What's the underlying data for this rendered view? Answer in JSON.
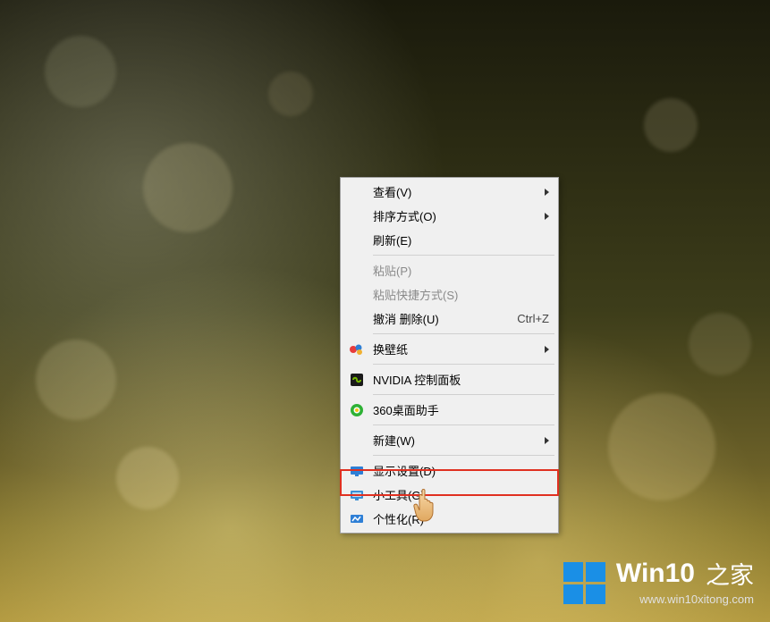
{
  "menu": {
    "view": {
      "label": "查看(V)"
    },
    "sort": {
      "label": "排序方式(O)"
    },
    "refresh": {
      "label": "刷新(E)"
    },
    "paste": {
      "label": "粘贴(P)"
    },
    "paste_shortcut": {
      "label": "粘贴快捷方式(S)"
    },
    "undo_delete": {
      "label": "撤消 删除(U)",
      "shortcut": "Ctrl+Z"
    },
    "change_wallpaper": {
      "label": "换壁纸"
    },
    "nvidia": {
      "label": "NVIDIA 控制面板"
    },
    "assistant_360": {
      "label": "360桌面助手"
    },
    "new": {
      "label": "新建(W)"
    },
    "display_settings": {
      "label": "显示设置(D)"
    },
    "gadgets": {
      "label": "小工具(G)"
    },
    "personalize": {
      "label": "个性化(R)"
    }
  },
  "watermark": {
    "title": "Win10",
    "subtitle": "之家",
    "url": "www.win10xitong.com"
  }
}
